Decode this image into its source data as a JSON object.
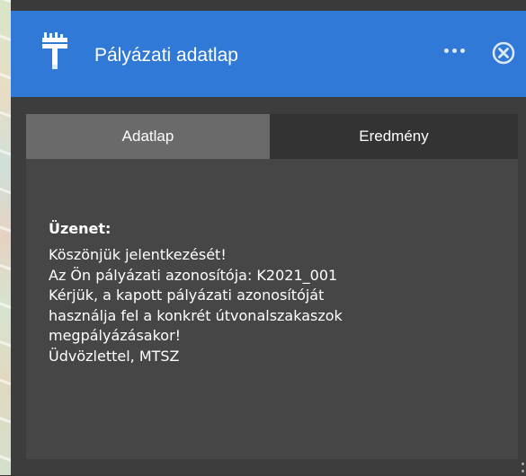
{
  "window": {
    "title": "Pályázati adatlap",
    "icons": {
      "app": "paint-brush-icon",
      "more": "more-horizontal-icon",
      "close": "close-circle-icon"
    },
    "colors": {
      "header": "#3079d6",
      "body": "#464646",
      "tab_inactive": "#6a6a6a",
      "tab_active": "#333333"
    }
  },
  "tabs": [
    {
      "label": "Adatlap",
      "active": false
    },
    {
      "label": "Eredmény",
      "active": true
    }
  ],
  "message": {
    "label": "Üzenet:",
    "lines": [
      "Köszönjük jelentkezését!",
      "Az Ön pályázati azonosítója: K2021_001",
      "Kérjük, a kapott pályázati azonosítóját",
      "használja fel a konkrét útvonalszakaszok",
      "megpályázásakor!",
      "Üdvözlettel, MTSZ"
    ]
  }
}
